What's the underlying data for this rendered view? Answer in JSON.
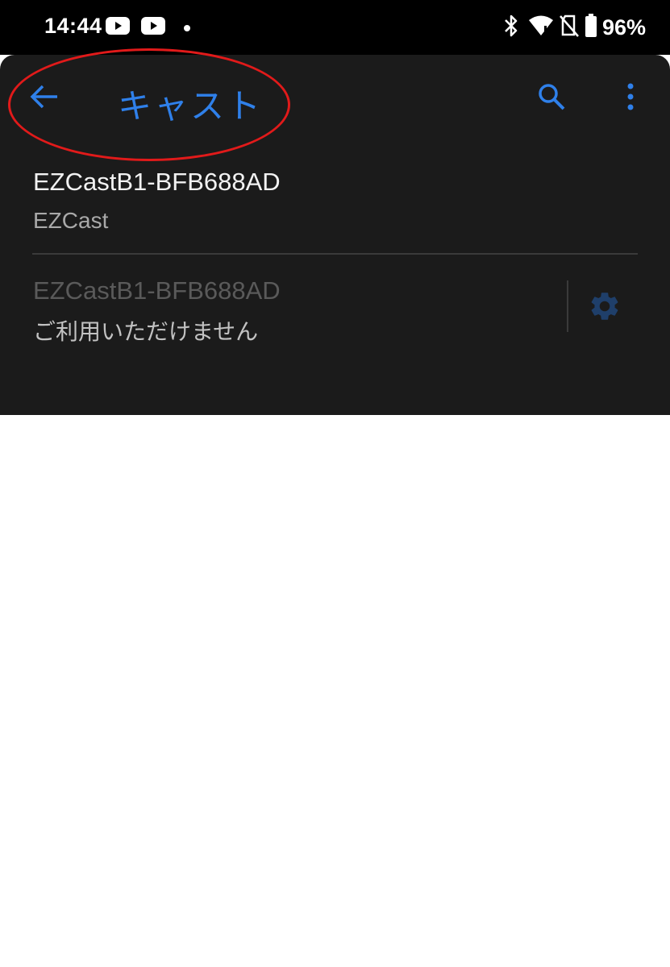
{
  "status_bar": {
    "time": "14:44",
    "battery_text": "96%",
    "icons": [
      "youtube-icon",
      "youtube-icon",
      "dot-icon",
      "bluetooth-icon",
      "wifi-icon",
      "no-sim-icon",
      "battery-icon"
    ]
  },
  "top_bar": {
    "title": "キャスト",
    "icons": [
      "back-arrow-icon",
      "search-icon",
      "more-vert-icon"
    ],
    "accent_color": "#2f80ea"
  },
  "annotation": {
    "shape": "ellipse",
    "color": "#e11a1a"
  },
  "devices": [
    {
      "name": "EZCastB1-BFB688AD",
      "subtitle": "EZCast"
    },
    {
      "name": "EZCastB1-BFB688AD",
      "subtitle": "ご利用いただけません",
      "action_icon": "gear-icon",
      "available": false
    }
  ],
  "colors": {
    "panel_background": "#1b1b1b",
    "status_background": "#000000",
    "page_background": "#ffffff"
  }
}
